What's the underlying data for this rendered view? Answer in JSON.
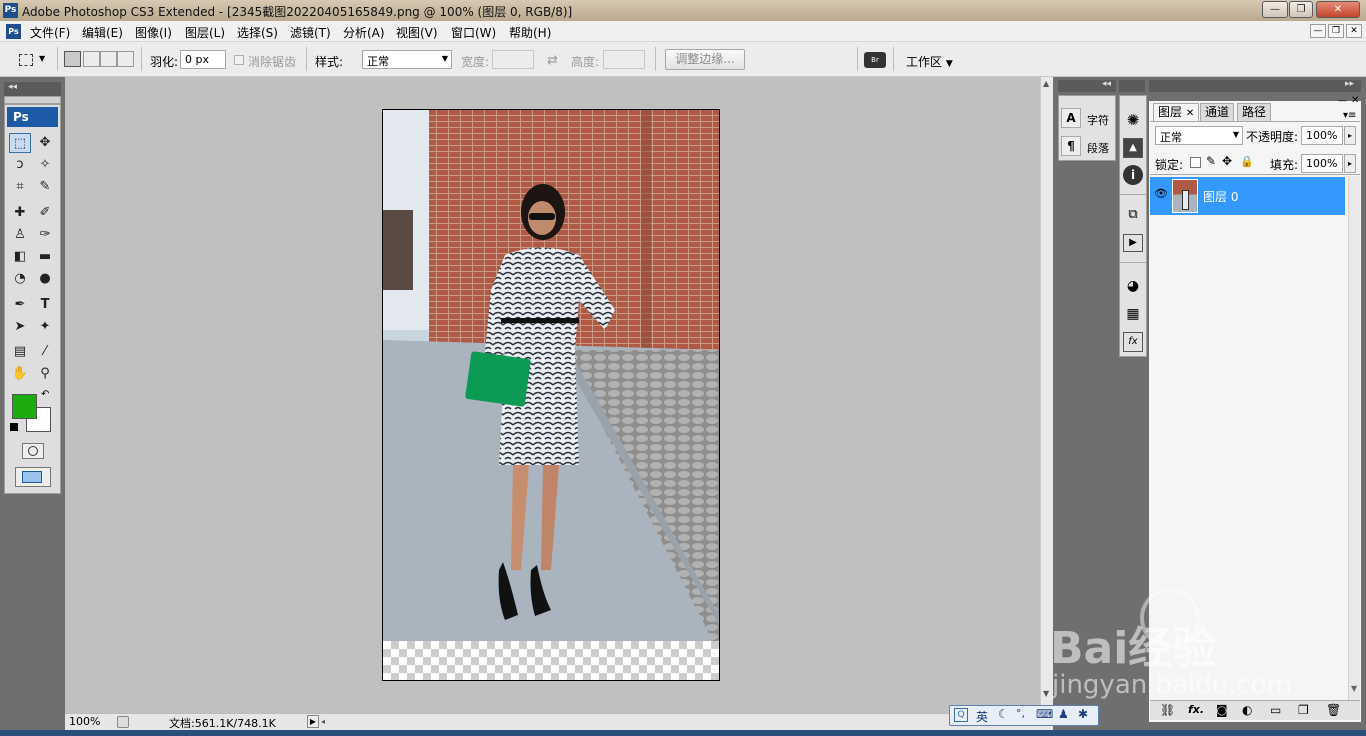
{
  "window": {
    "title": "Adobe Photoshop CS3 Extended - [2345截图20220405165849.png @ 100% (图层 0, RGB/8)]",
    "app_icon": "Ps",
    "buttons": {
      "minimize": "—",
      "maximize": "❐",
      "close": "✕"
    }
  },
  "menubar": {
    "items": [
      "文件(F)",
      "编辑(E)",
      "图像(I)",
      "图层(L)",
      "选择(S)",
      "滤镜(T)",
      "分析(A)",
      "视图(V)",
      "窗口(W)",
      "帮助(H)"
    ]
  },
  "options": {
    "feather_label": "羽化:",
    "feather_value": "0 px",
    "antialias_label": "消除锯齿",
    "style_label": "样式:",
    "style_value": "正常",
    "width_label": "宽度:",
    "height_label": "高度:",
    "refine_button": "调整边缘...",
    "workspace_label": "工作区"
  },
  "toolbox": {
    "logo": "Ps",
    "foreground_color": "#1aad0d",
    "background_color": "#ffffff"
  },
  "status": {
    "zoom": "100%",
    "doc_info": "文档:561.1K/748.1K"
  },
  "char_panel": {
    "character": "字符",
    "paragraph": "段落"
  },
  "layers_panel": {
    "tabs": [
      "图层",
      "通道",
      "路径"
    ],
    "blend_mode": "正常",
    "opacity_label": "不透明度:",
    "opacity_value": "100%",
    "lock_label": "锁定:",
    "fill_label": "填充:",
    "fill_value": "100%",
    "layers": [
      {
        "name": "图层 0"
      }
    ],
    "bottom_icons": [
      "link-icon",
      "fx-icon",
      "mask-icon",
      "adjustment-icon",
      "group-icon",
      "new-layer-icon",
      "trash-icon"
    ]
  },
  "ime": {
    "lang": "英"
  },
  "watermark": {
    "brand": "Bai经验",
    "url": "jingyan.baidu.com"
  }
}
